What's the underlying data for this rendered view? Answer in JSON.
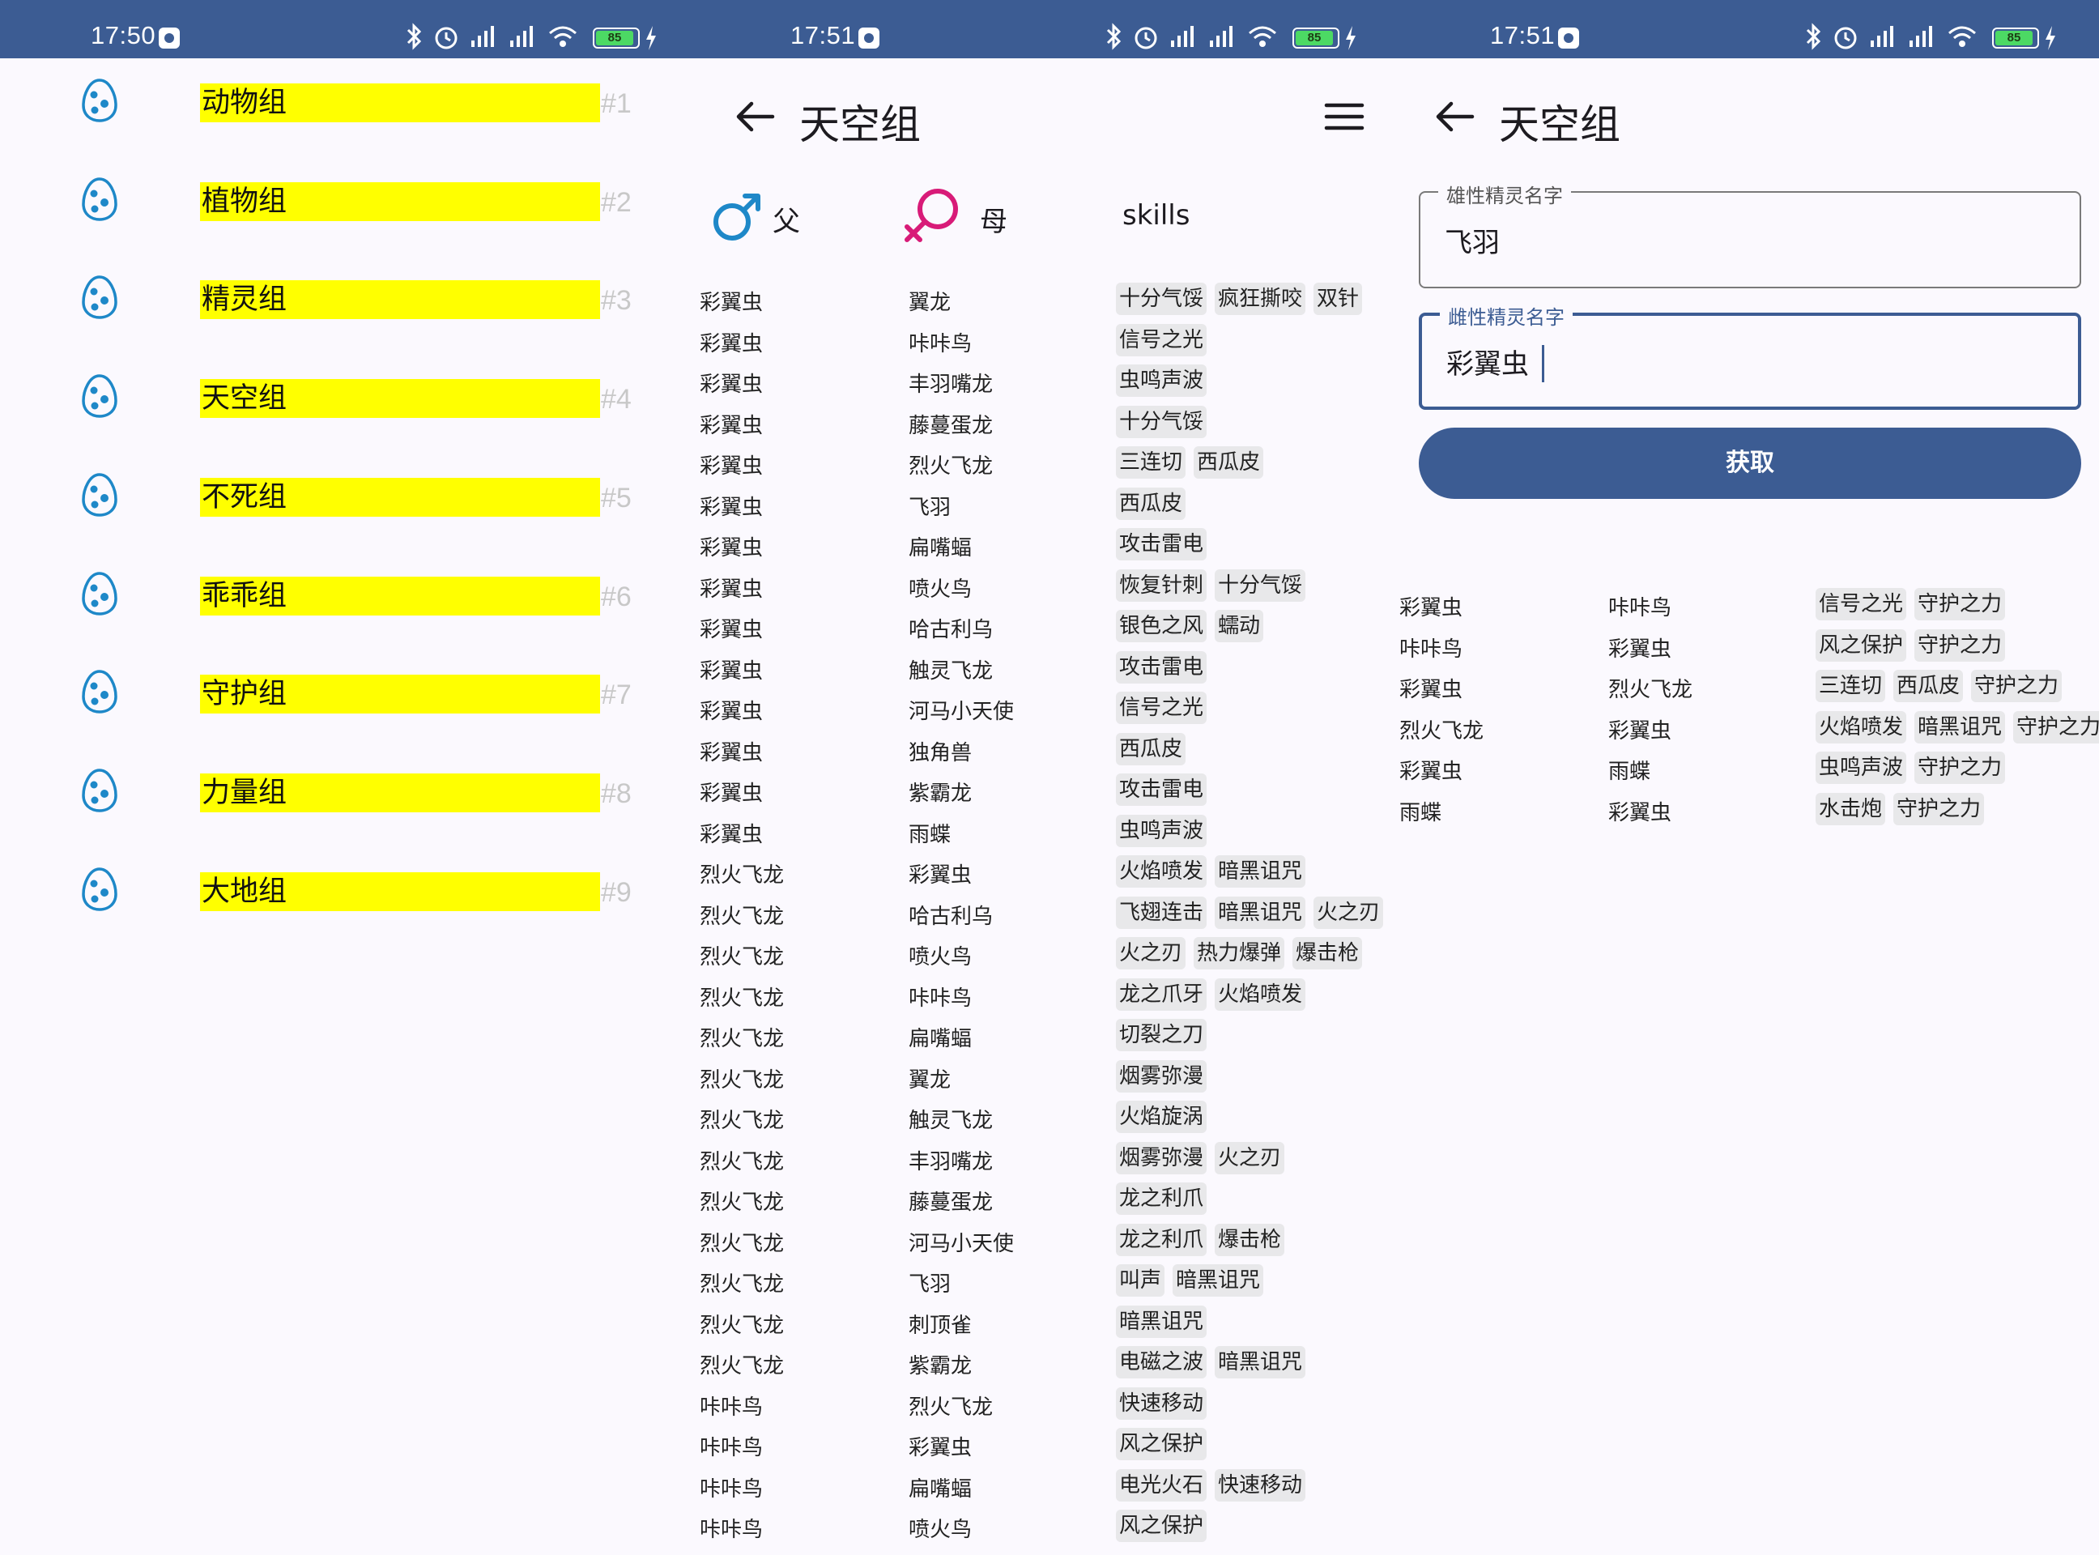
{
  "screens": {
    "groups": {
      "status_time": "17:50",
      "battery": "85",
      "items": [
        {
          "label": "动物组",
          "num": "#1"
        },
        {
          "label": "植物组",
          "num": "#2"
        },
        {
          "label": "精灵组",
          "num": "#3"
        },
        {
          "label": "天空组",
          "num": "#4"
        },
        {
          "label": "不死组",
          "num": "#5"
        },
        {
          "label": "乖乖组",
          "num": "#6"
        },
        {
          "label": "守护组",
          "num": "#7"
        },
        {
          "label": "力量组",
          "num": "#8"
        },
        {
          "label": "大地组",
          "num": "#9"
        }
      ]
    },
    "group_detail": {
      "status_time": "17:51",
      "battery": "85",
      "title": "天空组",
      "col_father": "父",
      "col_mother": "母",
      "col_skills": "skills",
      "rows": [
        {
          "f": "彩翼虫",
          "m": "翼龙",
          "s": [
            "十分气馁",
            "疯狂撕咬",
            "双针"
          ]
        },
        {
          "f": "彩翼虫",
          "m": "咔咔鸟",
          "s": [
            "信号之光"
          ]
        },
        {
          "f": "彩翼虫",
          "m": "丰羽嘴龙",
          "s": [
            "虫鸣声波"
          ]
        },
        {
          "f": "彩翼虫",
          "m": "藤蔓蛋龙",
          "s": [
            "十分气馁"
          ]
        },
        {
          "f": "彩翼虫",
          "m": "烈火飞龙",
          "s": [
            "三连切",
            "西瓜皮"
          ]
        },
        {
          "f": "彩翼虫",
          "m": "飞羽",
          "s": [
            "西瓜皮"
          ]
        },
        {
          "f": "彩翼虫",
          "m": "扁嘴蝠",
          "s": [
            "攻击雷电"
          ]
        },
        {
          "f": "彩翼虫",
          "m": "喷火鸟",
          "s": [
            "恢复针刺",
            "十分气馁"
          ]
        },
        {
          "f": "彩翼虫",
          "m": "哈古利乌",
          "s": [
            "银色之风",
            "蠕动"
          ]
        },
        {
          "f": "彩翼虫",
          "m": "触灵飞龙",
          "s": [
            "攻击雷电"
          ]
        },
        {
          "f": "彩翼虫",
          "m": "河马小天使",
          "s": [
            "信号之光"
          ]
        },
        {
          "f": "彩翼虫",
          "m": "独角兽",
          "s": [
            "西瓜皮"
          ]
        },
        {
          "f": "彩翼虫",
          "m": "紫霸龙",
          "s": [
            "攻击雷电"
          ]
        },
        {
          "f": "彩翼虫",
          "m": "雨蝶",
          "s": [
            "虫鸣声波"
          ]
        },
        {
          "f": "烈火飞龙",
          "m": "彩翼虫",
          "s": [
            "火焰喷发",
            "暗黑诅咒"
          ]
        },
        {
          "f": "烈火飞龙",
          "m": "哈古利乌",
          "s": [
            "飞翅连击",
            "暗黑诅咒",
            "火之刃"
          ]
        },
        {
          "f": "烈火飞龙",
          "m": "喷火鸟",
          "s": [
            "火之刃",
            "热力爆弹",
            "爆击枪"
          ]
        },
        {
          "f": "烈火飞龙",
          "m": "咔咔鸟",
          "s": [
            "龙之爪牙",
            "火焰喷发"
          ]
        },
        {
          "f": "烈火飞龙",
          "m": "扁嘴蝠",
          "s": [
            "切裂之刀"
          ]
        },
        {
          "f": "烈火飞龙",
          "m": "翼龙",
          "s": [
            "烟雾弥漫"
          ]
        },
        {
          "f": "烈火飞龙",
          "m": "触灵飞龙",
          "s": [
            "火焰旋涡"
          ]
        },
        {
          "f": "烈火飞龙",
          "m": "丰羽嘴龙",
          "s": [
            "烟雾弥漫",
            "火之刃"
          ]
        },
        {
          "f": "烈火飞龙",
          "m": "藤蔓蛋龙",
          "s": [
            "龙之利爪"
          ]
        },
        {
          "f": "烈火飞龙",
          "m": "河马小天使",
          "s": [
            "龙之利爪",
            "爆击枪"
          ]
        },
        {
          "f": "烈火飞龙",
          "m": "飞羽",
          "s": [
            "叫声",
            "暗黑诅咒"
          ]
        },
        {
          "f": "烈火飞龙",
          "m": "刺顶雀",
          "s": [
            "暗黑诅咒"
          ]
        },
        {
          "f": "烈火飞龙",
          "m": "紫霸龙",
          "s": [
            "电磁之波",
            "暗黑诅咒"
          ]
        },
        {
          "f": "咔咔鸟",
          "m": "烈火飞龙",
          "s": [
            "快速移动"
          ]
        },
        {
          "f": "咔咔鸟",
          "m": "彩翼虫",
          "s": [
            "风之保护"
          ]
        },
        {
          "f": "咔咔鸟",
          "m": "扁嘴蝠",
          "s": [
            "电光火石",
            "快速移动"
          ]
        },
        {
          "f": "咔咔鸟",
          "m": "喷火鸟",
          "s": [
            "风之保护"
          ]
        }
      ]
    },
    "query": {
      "status_time": "17:51",
      "battery": "85",
      "title": "天空组",
      "male_label": "雄性精灵名字",
      "male_value": "飞羽",
      "female_label": "雌性精灵名字",
      "female_value": "彩翼虫",
      "button_label": "获取",
      "results": [
        {
          "f": "彩翼虫",
          "m": "咔咔鸟",
          "s": [
            "信号之光",
            "守护之力"
          ]
        },
        {
          "f": "咔咔鸟",
          "m": "彩翼虫",
          "s": [
            "风之保护",
            "守护之力"
          ]
        },
        {
          "f": "彩翼虫",
          "m": "烈火飞龙",
          "s": [
            "三连切",
            "西瓜皮",
            "守护之力"
          ]
        },
        {
          "f": "烈火飞龙",
          "m": "彩翼虫",
          "s": [
            "火焰喷发",
            "暗黑诅咒",
            "守护之力"
          ]
        },
        {
          "f": "彩翼虫",
          "m": "雨蝶",
          "s": [
            "虫鸣声波",
            "守护之力"
          ]
        },
        {
          "f": "雨蝶",
          "m": "彩翼虫",
          "s": [
            "水击炮",
            "守护之力"
          ]
        }
      ]
    }
  },
  "icons": {
    "back": "arrow-back-icon",
    "menu": "hamburger-menu-icon",
    "egg": "egg-icon",
    "male": "male-symbol-icon",
    "female": "female-symbol-icon"
  },
  "colors": {
    "primary": "#3c5c93",
    "highlight": "#ffff00",
    "male_blue": "#1e88c8",
    "female_pink": "#d81b78",
    "chip_bg": "#e8e8ea"
  }
}
